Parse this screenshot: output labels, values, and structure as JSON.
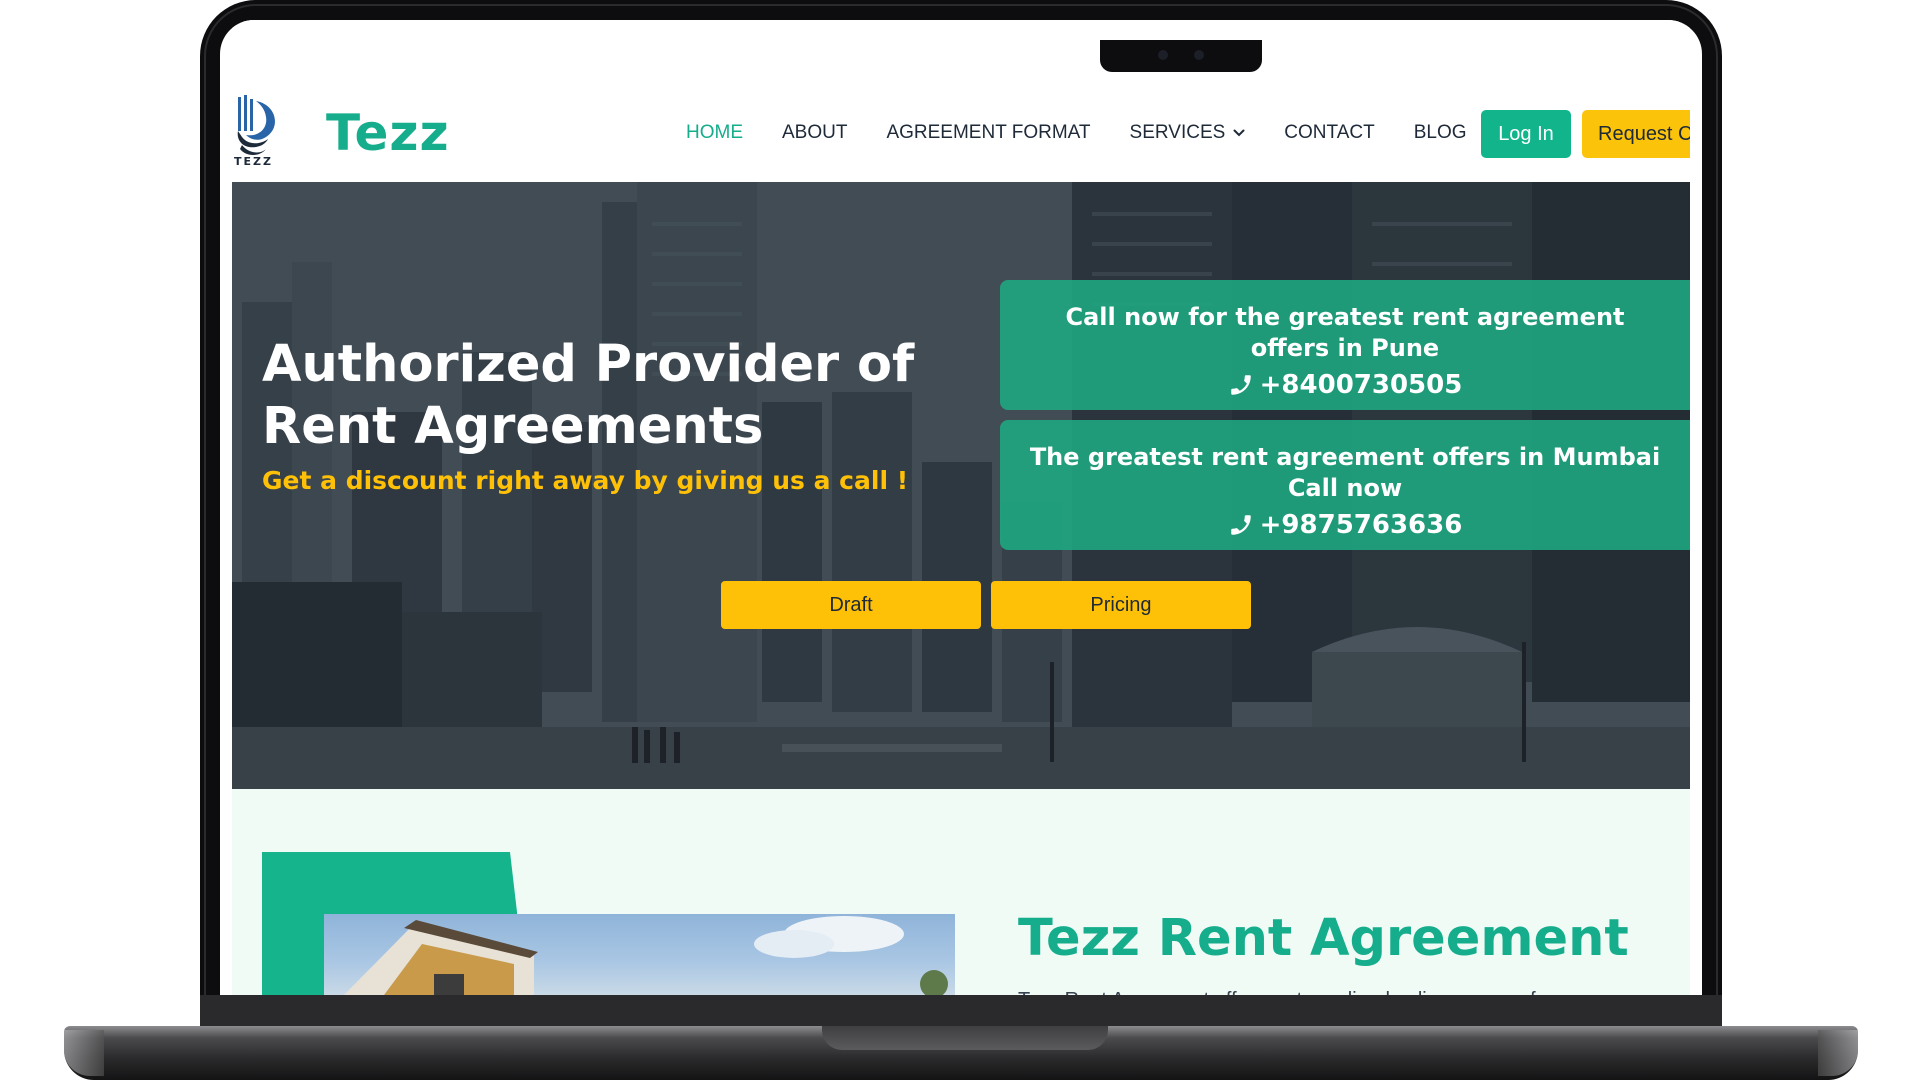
{
  "header": {
    "logo_caption": "TEZZ",
    "brand": "Tezz",
    "nav": [
      {
        "label": "HOME",
        "active": true
      },
      {
        "label": "ABOUT"
      },
      {
        "label": "AGREEMENT FORMAT"
      },
      {
        "label": "SERVICES"
      },
      {
        "label": "CONTACT"
      },
      {
        "label": "BLOG"
      }
    ],
    "login_label": "Log In",
    "request_label": "Request C"
  },
  "hero": {
    "title": "Authorized Provider of Rent Agreements",
    "subtitle": "Get a discount right away by giving us a call !",
    "offers": [
      {
        "text": "Call now for the greatest rent agreement offers in Pune",
        "phone": "+8400730505"
      },
      {
        "text": "The greatest rent agreement offers in Mumbai Call now",
        "phone": "+9875763636"
      }
    ],
    "draft_label": "Draft",
    "pricing_label": "Pricing"
  },
  "section": {
    "title": "Tezz Rent Agreement",
    "body": "Tezz Rent Agreement offers a streamlined online process for your"
  },
  "colors": {
    "brand_green": "#16ad8c",
    "accent_yellow": "#ffc107",
    "text_dark": "#1e2a38",
    "section_bg": "#effbf4"
  },
  "icons": [
    "chevron-down-icon",
    "phone-icon",
    "tezz-logo"
  ]
}
